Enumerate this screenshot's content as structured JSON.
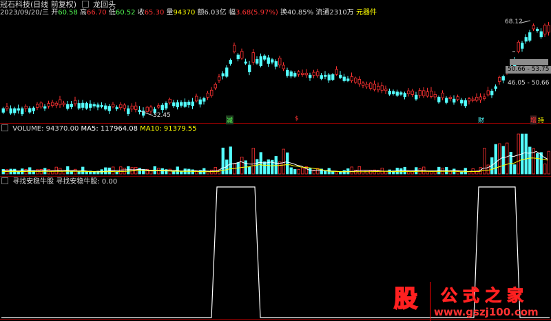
{
  "header": {
    "title": "冠石科技(日线 前复权)",
    "indicator_name": "龙回头"
  },
  "quote": {
    "date": "2023/09/20/三",
    "open_label": "开",
    "open": "60.58",
    "high_label": "高",
    "high": "66.70",
    "low_label": "低",
    "low": "60.52",
    "close_label": "收",
    "close": "65.30",
    "vol_label": "量",
    "vol": "94370",
    "amount_label": "额",
    "amount": "6.03亿",
    "amp_label": "幅",
    "amp": "3.68(5.97%)",
    "turnover_label": "换",
    "turnover": "40.85%",
    "float_label": "流通",
    "float": "2310万",
    "sector": "元器件"
  },
  "price_panel": {
    "high_label": "68.12",
    "low_label": "32.45",
    "box1": "50.66 - 53.75",
    "box2": "46.05 - 50.66",
    "marks": [
      "减",
      "$",
      "财",
      "增",
      "持"
    ]
  },
  "volume_panel": {
    "label": "VOLUME: 94370.00",
    "ma5": "MA5: 117964.08",
    "ma10": "MA10: 91379.55"
  },
  "indicator_panel": {
    "title": "寻找安稳牛股",
    "value": "寻找安稳牛股: 0.00"
  },
  "watermark": {
    "logo": "股",
    "name": "公式之家",
    "url": "www.gszj100.com"
  },
  "colors": {
    "up": "#ff3232",
    "down": "#54ffff",
    "ma5": "#ffffff",
    "ma10": "#ffff00",
    "accent": "#ff0000"
  }
}
